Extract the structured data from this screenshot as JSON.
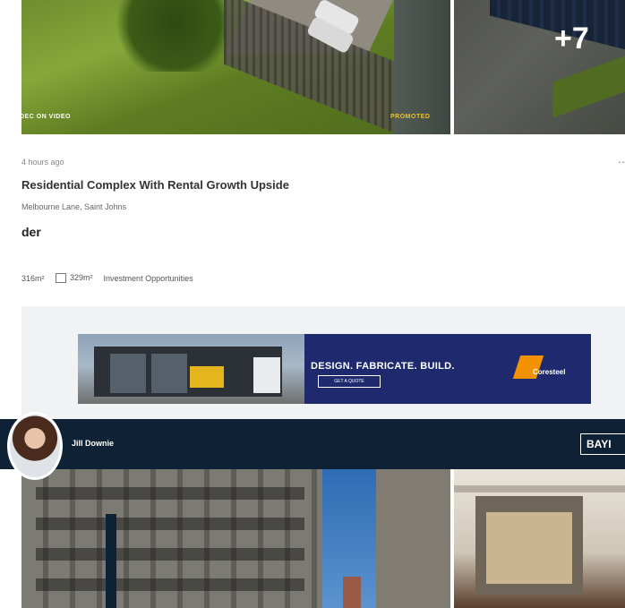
{
  "listing1": {
    "photo_tag_left": "DEC ON VIDEO",
    "photo_tag_right": "PROMOTED",
    "more_photos": "+7",
    "date": "4 hours ago",
    "title": "Residential Complex With Rental Growth Upside",
    "address": "Melbourne Lane, Saint Johns",
    "price": "der",
    "stats": {
      "building_area": "316m²",
      "land_area": "329m²",
      "category": "Investment Opportunities"
    },
    "more_icon": "ellipsis-icon"
  },
  "ad": {
    "headline": "DESIGN. FABRICATE. BUILD.",
    "cta": "GET A QUOTE",
    "logo_name": "Coresteel",
    "colors": {
      "background": "#1f2a6e",
      "logo_accent": "#f39200"
    }
  },
  "listing2": {
    "agent_name": "Jill Downie",
    "brand": "BAYI",
    "colors": {
      "agent_bar": "#0f2235"
    }
  }
}
